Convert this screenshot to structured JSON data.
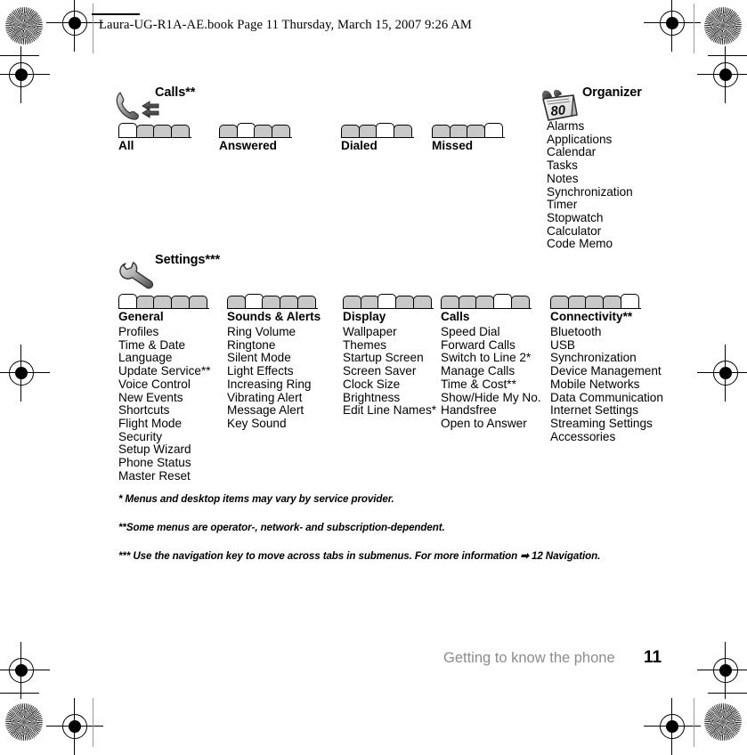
{
  "header": {
    "text": "Laura-UG-R1A-AE.book  Page 11  Thursday, March 15, 2007  9:26 AM"
  },
  "sections": {
    "calls": {
      "title": "Calls**",
      "icon": "phone-handset-arrows-icon",
      "tab_groups": [
        {
          "label": "All",
          "count": 4,
          "active": 1
        },
        {
          "label": "Answered",
          "count": 4,
          "active": 2
        },
        {
          "label": "Dialed",
          "count": 4,
          "active": 3
        },
        {
          "label": "Missed",
          "count": 4,
          "active": 4
        }
      ]
    },
    "organizer": {
      "title": "Organizer",
      "icon": "alarm-clock-calendar-icon",
      "items": [
        "Alarms",
        "Applications",
        "Calendar",
        "Tasks",
        "Notes",
        "Synchronization",
        "Timer",
        "Stopwatch",
        "Calculator",
        "Code Memo"
      ]
    },
    "settings": {
      "title": "Settings***",
      "icon": "wrench-icon",
      "columns": [
        {
          "label": "General",
          "tabs": {
            "count": 5,
            "active": 1
          },
          "items": [
            "Profiles",
            "Time & Date",
            "Language",
            "Update Service**",
            "Voice Control",
            "New Events",
            "Shortcuts",
            "Flight Mode",
            "Security",
            "Setup Wizard",
            "Phone Status",
            "Master Reset"
          ]
        },
        {
          "label": "Sounds & Alerts",
          "tabs": {
            "count": 5,
            "active": 2
          },
          "items": [
            "Ring Volume",
            "Ringtone",
            "Silent Mode",
            "Light Effects",
            "Increasing Ring",
            "Vibrating Alert",
            "Message Alert",
            "Key Sound"
          ]
        },
        {
          "label": "Display",
          "tabs": {
            "count": 5,
            "active": 3
          },
          "items": [
            "Wallpaper",
            "Themes",
            "Startup Screen",
            "Screen Saver",
            "Clock Size",
            "Brightness",
            "Edit Line Names*"
          ]
        },
        {
          "label": "Calls",
          "tabs": {
            "count": 5,
            "active": 4
          },
          "items": [
            "Speed Dial",
            "Forward Calls",
            "Switch to Line 2*",
            "Manage Calls",
            "Time & Cost**",
            "Show/Hide My No.",
            "Handsfree",
            "Open to Answer"
          ]
        },
        {
          "label": "Connectivity**",
          "tabs": {
            "count": 5,
            "active": 5
          },
          "items": [
            "Bluetooth",
            "USB",
            "Synchronization",
            "Device Management",
            "Mobile Networks",
            "Data Communication",
            "Internet Settings",
            "Streaming Settings",
            "Accessories"
          ]
        }
      ]
    }
  },
  "footnotes": [
    "* Menus and desktop items may vary by service provider.",
    "**Some menus are operator-, network- and subscription-dependent.",
    "*** Use the navigation key to move across tabs in submenus. For more information ➡ 12 Navigation."
  ],
  "footer": {
    "section": "Getting to know the phone",
    "page_number": "11"
  },
  "colors": {
    "tab_fill": "#c8c8c8",
    "tab_active_fill": "#ffffff",
    "footer_section": "#8c8c8c",
    "rule": "#000000"
  }
}
